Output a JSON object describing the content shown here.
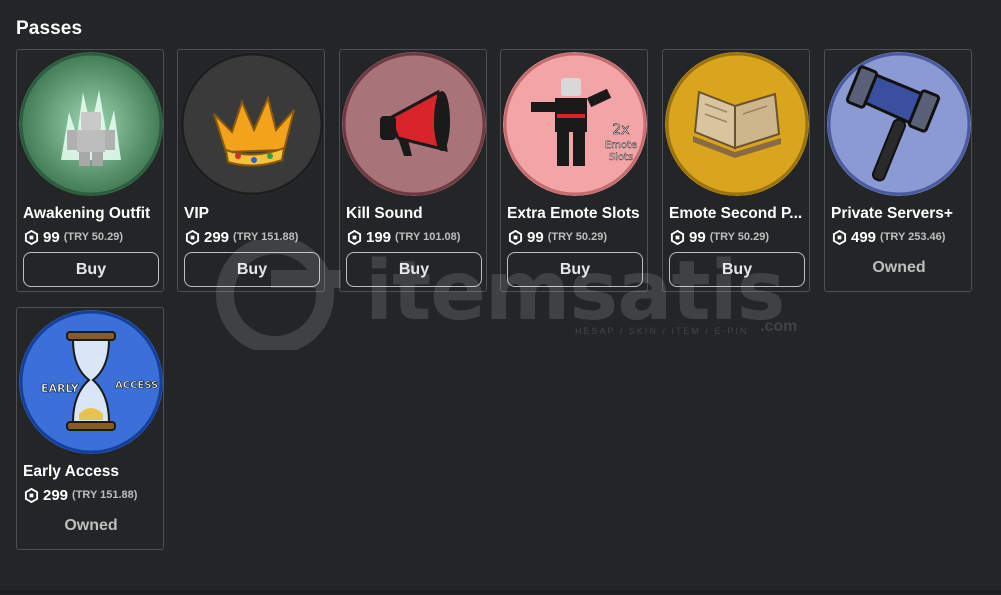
{
  "section": {
    "title": "Passes"
  },
  "passes": [
    {
      "name": "Awakening Outfit",
      "price": "99",
      "local_price": "(TRY 50.29)",
      "action": "Buy",
      "owned": false,
      "bg": "#5a9a6e",
      "icon": "awakening-figure-icon"
    },
    {
      "name": "VIP",
      "price": "299",
      "local_price": "(TRY 151.88)",
      "action": "Buy",
      "owned": false,
      "bg": "#2f2f2f",
      "icon": "crown-icon"
    },
    {
      "name": "Kill Sound",
      "price": "199",
      "local_price": "(TRY 101.08)",
      "action": "Buy",
      "owned": false,
      "bg": "#9c6a70",
      "icon": "megaphone-icon"
    },
    {
      "name": "Extra Emote Slots",
      "price": "99",
      "local_price": "(TRY 50.29)",
      "action": "Buy",
      "owned": false,
      "bg": "#f0a6a8",
      "icon": "dancing-avatar-icon"
    },
    {
      "name": "Emote Second P...",
      "price": "99",
      "local_price": "(TRY 50.29)",
      "action": "Buy",
      "owned": false,
      "bg": "#d9a51c",
      "icon": "open-book-icon"
    },
    {
      "name": "Private Servers+",
      "price": "499",
      "local_price": "(TRY 253.46)",
      "action": "Owned",
      "owned": true,
      "bg": "#8a98cf",
      "icon": "hammer-icon"
    },
    {
      "name": "Early Access",
      "price": "299",
      "local_price": "(TRY 151.88)",
      "action": "Owned",
      "owned": true,
      "bg": "#3a6fd6",
      "icon": "hourglass-icon",
      "art_text_left": "EARLY",
      "art_text_right": "ACCESS"
    }
  ],
  "extra_emote_art_text": "2x Emote Slots",
  "watermark": {
    "brand": "itemsatis",
    "sub": "HESAP / SKIN / ITEM / E-PIN",
    "suffix": ".com"
  },
  "colors": {
    "background": "#232527",
    "card_border": "#4d5054",
    "button_border": "#bdbebe",
    "muted_text": "#bdbebe"
  }
}
